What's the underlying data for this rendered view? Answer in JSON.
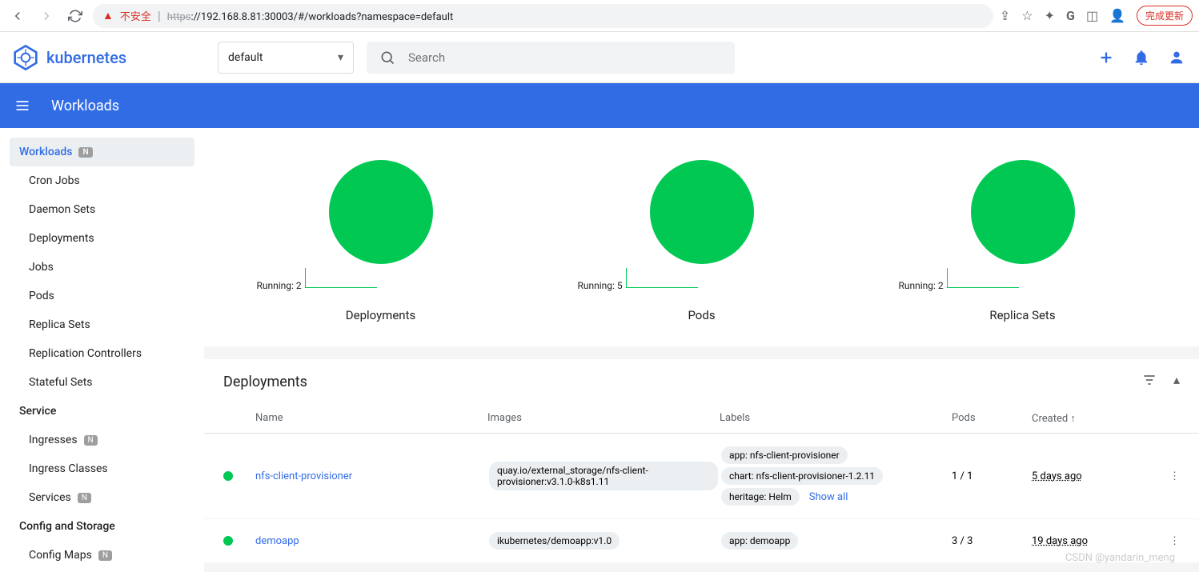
{
  "browser": {
    "insecure_label": "不安全",
    "url_https": "https",
    "url_rest": "://192.168.8.81:30003/#/workloads?namespace=default",
    "update_btn": "完成更新"
  },
  "header": {
    "logo_text": "kubernetes",
    "namespace": "default",
    "search_placeholder": "Search"
  },
  "bluebar": {
    "title": "Workloads"
  },
  "sidebar": {
    "items": [
      {
        "label": "Workloads",
        "active": true,
        "badge": "N",
        "sub": false
      },
      {
        "label": "Cron Jobs",
        "sub": true
      },
      {
        "label": "Daemon Sets",
        "sub": true
      },
      {
        "label": "Deployments",
        "sub": true
      },
      {
        "label": "Jobs",
        "sub": true
      },
      {
        "label": "Pods",
        "sub": true
      },
      {
        "label": "Replica Sets",
        "sub": true
      },
      {
        "label": "Replication Controllers",
        "sub": true
      },
      {
        "label": "Stateful Sets",
        "sub": true
      },
      {
        "label": "Service",
        "section": true
      },
      {
        "label": "Ingresses",
        "sub": true,
        "badge": "N"
      },
      {
        "label": "Ingress Classes",
        "sub": true
      },
      {
        "label": "Services",
        "sub": true,
        "badge": "N"
      },
      {
        "label": "Config and Storage",
        "section": true
      },
      {
        "label": "Config Maps",
        "sub": true,
        "badge": "N"
      }
    ]
  },
  "chart_data": [
    {
      "type": "pie",
      "title": "Deployments",
      "label": "Running: 2",
      "series": [
        {
          "name": "Running",
          "value": 2
        }
      ]
    },
    {
      "type": "pie",
      "title": "Pods",
      "label": "Running: 5",
      "series": [
        {
          "name": "Running",
          "value": 5
        }
      ]
    },
    {
      "type": "pie",
      "title": "Replica Sets",
      "label": "Running: 2",
      "series": [
        {
          "name": "Running",
          "value": 2
        }
      ]
    }
  ],
  "deployments": {
    "title": "Deployments",
    "columns": {
      "name": "Name",
      "images": "Images",
      "labels": "Labels",
      "pods": "Pods",
      "created": "Created ↑"
    },
    "show_all": "Show all",
    "rows": [
      {
        "name": "nfs-client-provisioner",
        "images": "quay.io/external_storage/nfs-client-provisioner:v3.1.0-k8s1.11",
        "labels": [
          "app: nfs-client-provisioner",
          "chart: nfs-client-provisioner-1.2.11",
          "heritage: Helm"
        ],
        "pods": "1 / 1",
        "created": "5 days ago",
        "show_all": true
      },
      {
        "name": "demoapp",
        "images": "ikubernetes/demoapp:v1.0",
        "labels": [
          "app: demoapp"
        ],
        "pods": "3 / 3",
        "created": "19 days ago"
      }
    ]
  },
  "watermark": "CSDN @yandarin_meng"
}
